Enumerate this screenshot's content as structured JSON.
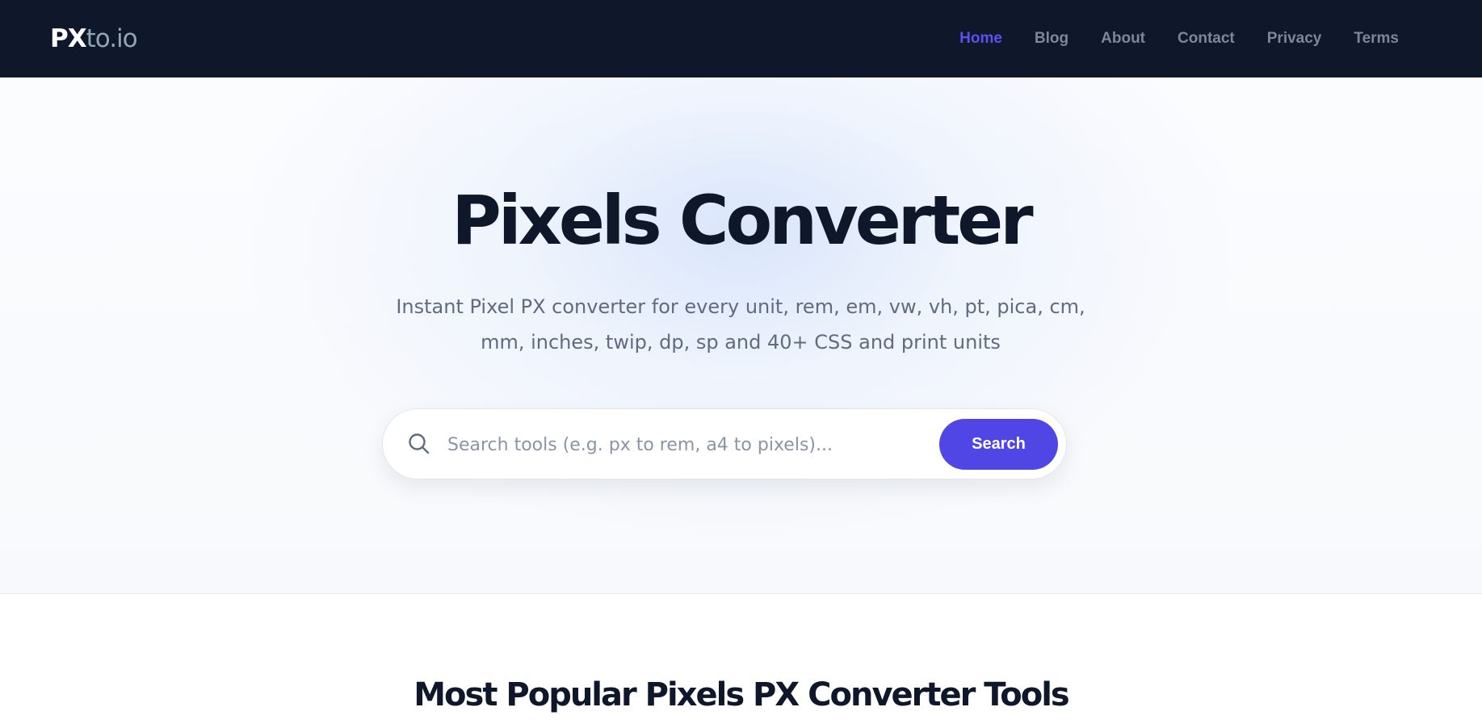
{
  "header": {
    "logo_strong": "PX",
    "logo_light": "to.io",
    "nav": [
      {
        "label": "Home",
        "active": true
      },
      {
        "label": "Blog",
        "active": false
      },
      {
        "label": "About",
        "active": false
      },
      {
        "label": "Contact",
        "active": false
      },
      {
        "label": "Privacy",
        "active": false
      },
      {
        "label": "Terms",
        "active": false
      }
    ]
  },
  "hero": {
    "title": "Pixels Converter",
    "subtitle": "Instant Pixel PX converter for every unit, rem, em, vw, vh, pt, pica, cm, mm, inches, twip, dp, sp and 40+ CSS and print units"
  },
  "search": {
    "placeholder": "Search tools (e.g. px to rem, a4 to pixels)...",
    "value": "",
    "button_label": "Search",
    "icon": "search-icon"
  },
  "sections": {
    "popular_title": "Most Popular Pixels PX Converter Tools"
  },
  "colors": {
    "header_bg": "#0f172a",
    "nav_active": "#5b50f0",
    "nav_inactive": "#7c879c",
    "accent": "#4f46e5",
    "title_text": "#0f172a",
    "subtitle_text": "#5f6b80"
  }
}
